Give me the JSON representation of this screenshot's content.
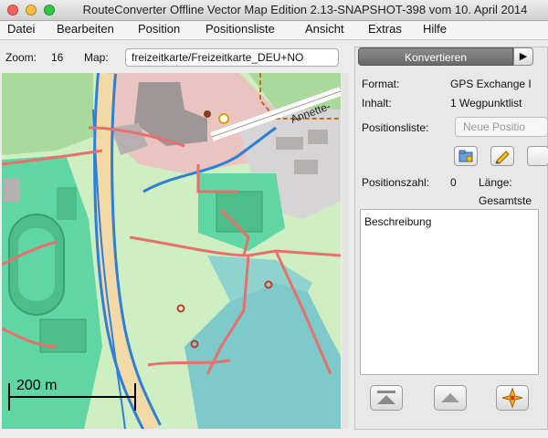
{
  "window": {
    "title": "RouteConverter Offline Vector Map Edition 2.13-SNAPSHOT-398 vom 10. April 2014"
  },
  "menu": {
    "items": [
      "Datei",
      "Bearbeiten",
      "Position",
      "Positionsliste",
      "Ansicht",
      "Extras",
      "Hilfe"
    ]
  },
  "map_toolbar": {
    "zoom_label": "Zoom:",
    "zoom_value": "16",
    "map_label": "Map:",
    "map_value": "freizeitkarte/Freizeitkarte_DEU+NO"
  },
  "map": {
    "street_label": "Annette-",
    "scale_label": "200 m",
    "colors": {
      "land": "#cfeec2",
      "park": "#5fd6a4",
      "water": "#7ec9c9",
      "road_main": "#f3d9a6",
      "road_edge": "#2f7fd6",
      "path": "#e8706c",
      "building_area": "#e9c4c0"
    }
  },
  "panel": {
    "convert_button": "Konvertieren",
    "format_label": "Format:",
    "format_value": "GPS Exchange I",
    "content_label": "Inhalt:",
    "content_value": "1 Wegpunktlist",
    "position_list_label": "Positionsliste:",
    "position_list_value": "Neue Positio",
    "position_count_label": "Positionszahl:",
    "position_count_value": "0",
    "length_label": "Länge:",
    "total_label": "Gesamtste",
    "description_placeholder": "Beschreibung"
  }
}
